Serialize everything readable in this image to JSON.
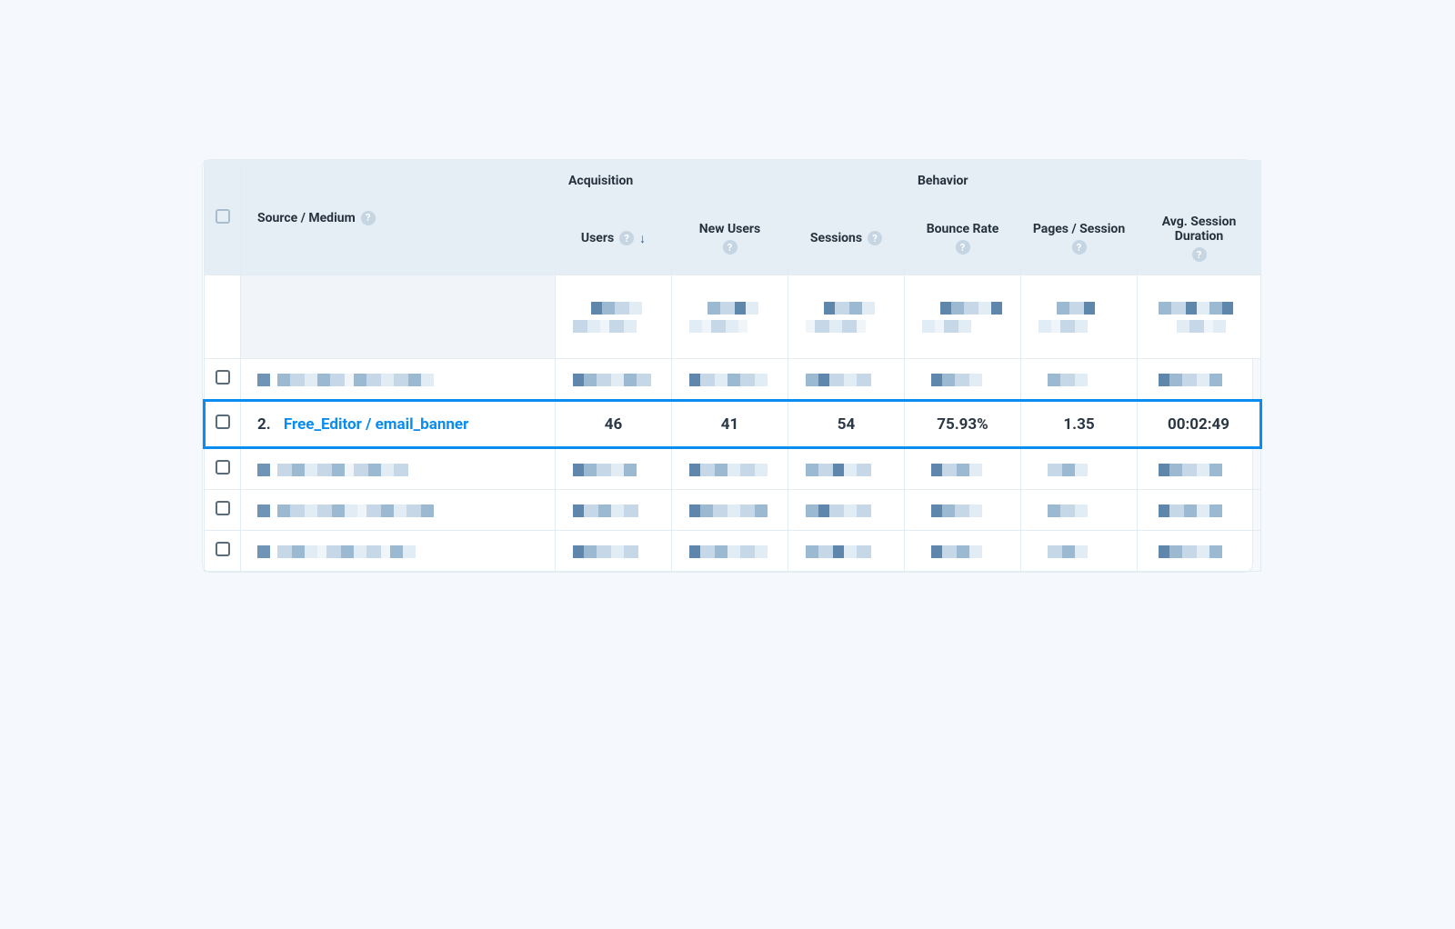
{
  "table": {
    "dimension_header": "Source / Medium",
    "groups": {
      "acquisition": "Acquisition",
      "behavior": "Behavior"
    },
    "columns": {
      "users": "Users",
      "new_users": "New Users",
      "sessions": "Sessions",
      "bounce_rate": "Bounce Rate",
      "pages_session": "Pages / Session",
      "avg_session_duration": "Avg. Session Duration"
    },
    "sort": {
      "column": "users",
      "direction": "desc"
    },
    "highlighted_row": {
      "index": "2.",
      "source_medium": "Free_Editor / email_banner",
      "users": "46",
      "new_users": "41",
      "sessions": "54",
      "bounce_rate": "75.93%",
      "pages_session": "1.35",
      "avg_session_duration": "00:02:49"
    }
  }
}
